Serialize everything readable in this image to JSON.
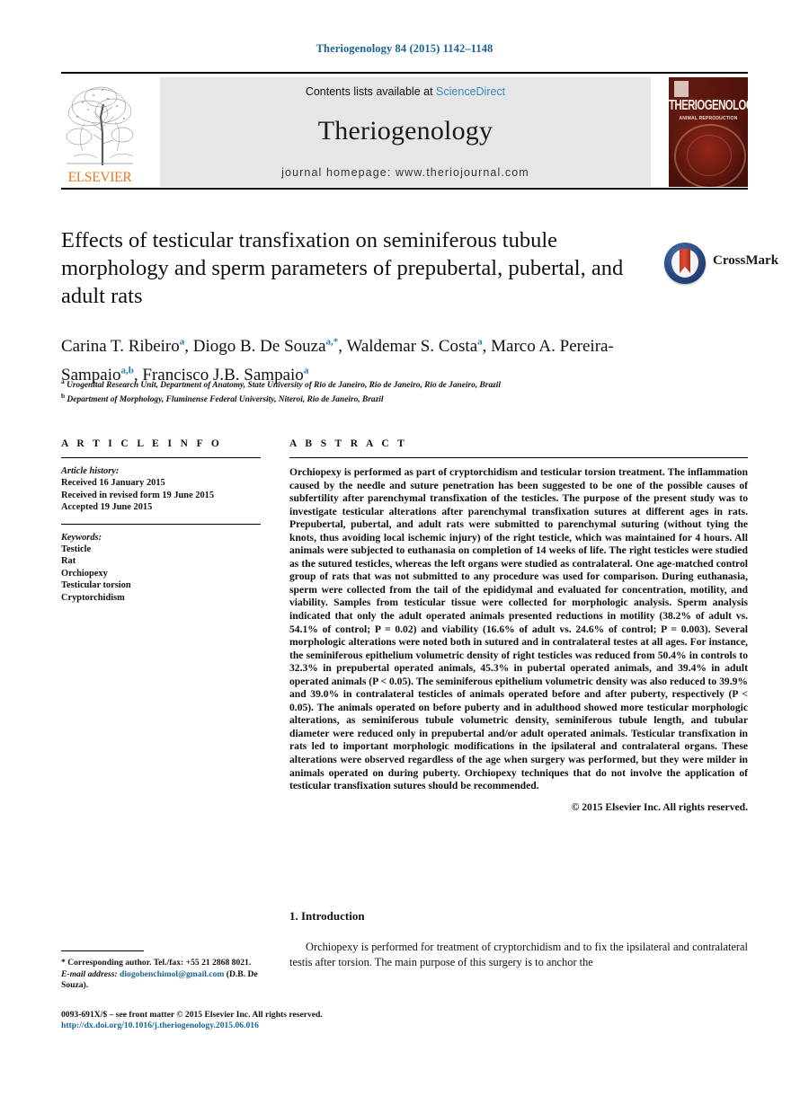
{
  "running_head": "Theriogenology 84 (2015) 1142–1148",
  "masthead": {
    "publisher": "ELSEVIER",
    "contents_prefix": "Contents lists available at",
    "contents_link": "ScienceDirect",
    "journal_name": "Theriogenology",
    "homepage": "journal homepage: www.theriojournal.com",
    "cover_title": "THERIOGENOLOGY",
    "cover_subtitle": "ANIMAL REPRODUCTION"
  },
  "article": {
    "title": "Effects of testicular transfixation on seminiferous tubule morphology and sperm parameters of prepubertal, pubertal, and adult rats",
    "crossmark_label": "CrossMark",
    "authors": [
      {
        "name": "Carina T. Ribeiro",
        "marks": "a"
      },
      {
        "name": "Diogo B. De Souza",
        "marks": "a,*"
      },
      {
        "name": "Waldemar S. Costa",
        "marks": "a"
      },
      {
        "name": "Marco A. Pereira-Sampaio",
        "marks": "a,b"
      },
      {
        "name": "Francisco J.B. Sampaio",
        "marks": "a"
      }
    ],
    "affiliations": [
      {
        "mark": "a",
        "text": "Urogenital Research Unit, Department of Anatomy, State University of Rio de Janeiro, Rio de Janeiro, Rio de Janeiro, Brazil"
      },
      {
        "mark": "b",
        "text": "Department of Morphology, Fluminense Federal University, Niteroi, Rio de Janeiro, Brazil"
      }
    ]
  },
  "article_info": {
    "heading": "A R T I C L E   I N F O",
    "history_label": "Article history:",
    "history": [
      "Received 16 January 2015",
      "Received in revised form 19 June 2015",
      "Accepted 19 June 2015"
    ],
    "keywords_label": "Keywords:",
    "keywords": [
      "Testicle",
      "Rat",
      "Orchiopexy",
      "Testicular torsion",
      "Cryptorchidism"
    ]
  },
  "abstract": {
    "heading": "A B S T R A C T",
    "text": "Orchiopexy is performed as part of cryptorchidism and testicular torsion treatment. The inflammation caused by the needle and suture penetration has been suggested to be one of the possible causes of subfertility after parenchymal transfixation of the testicles. The purpose of the present study was to investigate testicular alterations after parenchymal transfixation sutures at different ages in rats. Prepubertal, pubertal, and adult rats were submitted to parenchymal suturing (without tying the knots, thus avoiding local ischemic injury) of the right testicle, which was maintained for 4 hours. All animals were subjected to euthanasia on completion of 14 weeks of life. The right testicles were studied as the sutured testicles, whereas the left organs were studied as contralateral. One age-matched control group of rats that was not submitted to any procedure was used for comparison. During euthanasia, sperm were collected from the tail of the epididymal and evaluated for concentration, motility, and viability. Samples from testicular tissue were collected for morphologic analysis. Sperm analysis indicated that only the adult operated animals presented reductions in motility (38.2% of adult vs. 54.1% of control; P = 0.02) and viability (16.6% of adult vs. 24.6% of control; P = 0.003). Several morphologic alterations were noted both in sutured and in contralateral testes at all ages. For instance, the seminiferous epithelium volumetric density of right testicles was reduced from 50.4% in controls to 32.3% in prepubertal operated animals, 45.3% in pubertal operated animals, and 39.4% in adult operated animals (P < 0.05). The seminiferous epithelium volumetric density was also reduced to 39.9% and 39.0% in contralateral testicles of animals operated before and after puberty, respectively (P < 0.05). The animals operated on before puberty and in adulthood showed more testicular morphologic alterations, as seminiferous tubule volumetric density, seminiferous tubule length, and tubular diameter were reduced only in prepubertal and/or adult operated animals. Testicular transfixation in rats led to important morphologic modifications in the ipsilateral and contralateral organs. These alterations were observed regardless of the age when surgery was performed, but they were milder in animals operated on during puberty. Orchiopexy techniques that do not involve the application of testicular transfixation sutures should be recommended.",
    "copyright": "© 2015 Elsevier Inc. All rights reserved."
  },
  "introduction": {
    "heading": "1. Introduction",
    "text": "Orchiopexy is performed for treatment of cryptorchidism and to fix the ipsilateral and contralateral testis after torsion. The main purpose of this surgery is to anchor the"
  },
  "footnote": {
    "marker": "*",
    "corresponding": "Corresponding author. Tel./fax: +55 21 2868 8021.",
    "email_label": "E-mail address:",
    "email": "diogobenchimol@gmail.com",
    "email_owner": "(D.B. De Souza)."
  },
  "footer": {
    "issn_line": "0093-691X/$ – see front matter © 2015 Elsevier Inc. All rights reserved.",
    "doi": "http://dx.doi.org/10.1016/j.theriogenology.2015.06.016"
  }
}
